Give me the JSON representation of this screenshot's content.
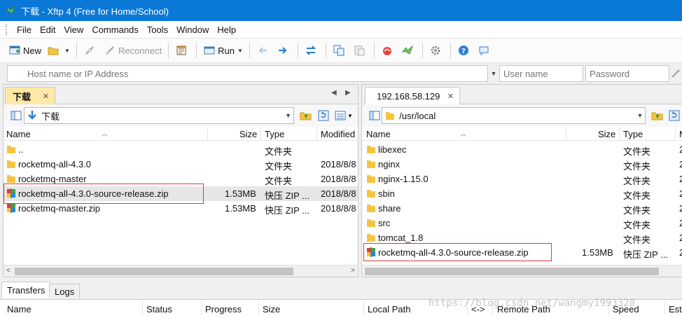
{
  "window": {
    "title": "下载 - Xftp 4 (Free for Home/School)"
  },
  "menu": [
    "File",
    "Edit",
    "View",
    "Commands",
    "Tools",
    "Window",
    "Help"
  ],
  "toolbar": {
    "new_label": "New",
    "reconnect_label": "Reconnect",
    "run_label": "Run"
  },
  "address": {
    "host_placeholder": "Host name or IP Address",
    "user_placeholder": "User name",
    "password_placeholder": "Password"
  },
  "columns": {
    "name": "Name",
    "size": "Size",
    "type": "Type",
    "modified": "Modified"
  },
  "left_pane": {
    "tab_label": "下载",
    "path": "下载",
    "files": [
      {
        "name": "..",
        "size": "",
        "type": "文件夹",
        "modified": ""
      },
      {
        "name": "rocketmq-all-4.3.0",
        "size": "",
        "type": "文件夹",
        "modified": "2018/8/8"
      },
      {
        "name": "rocketmq-master",
        "size": "",
        "type": "文件夹",
        "modified": "2018/8/8"
      },
      {
        "name": "rocketmq-all-4.3.0-source-release.zip",
        "size": "1.53MB",
        "type": "快压 ZIP ...",
        "modified": "2018/8/8"
      },
      {
        "name": "rocketmq-master.zip",
        "size": "1.53MB",
        "type": "快压 ZIP ...",
        "modified": "2018/8/8"
      }
    ]
  },
  "right_pane": {
    "tab_label": "192.168.58.129",
    "path": "/usr/local",
    "files": [
      {
        "name": "libexec",
        "size": "",
        "type": "文件夹",
        "modified": "2"
      },
      {
        "name": "nginx",
        "size": "",
        "type": "文件夹",
        "modified": "2"
      },
      {
        "name": "nginx-1.15.0",
        "size": "",
        "type": "文件夹",
        "modified": "2"
      },
      {
        "name": "sbin",
        "size": "",
        "type": "文件夹",
        "modified": "2"
      },
      {
        "name": "share",
        "size": "",
        "type": "文件夹",
        "modified": "2"
      },
      {
        "name": "src",
        "size": "",
        "type": "文件夹",
        "modified": "2"
      },
      {
        "name": "tomcat_1.8",
        "size": "",
        "type": "文件夹",
        "modified": "2"
      },
      {
        "name": "rocketmq-all-4.3.0-source-release.zip",
        "size": "1.53MB",
        "type": "快压 ZIP ...",
        "modified": "2"
      }
    ]
  },
  "bottom": {
    "tabs": [
      "Transfers",
      "Logs"
    ],
    "columns": [
      "Name",
      "Status",
      "Progress",
      "Size",
      "Local Path",
      "<->",
      "Remote Path",
      "Speed",
      "Esti"
    ]
  },
  "watermark": "https://blog.csdn.net/wangmy1993328",
  "colors": {
    "titlebar": "#0a78d7",
    "local_tab": "#fde8a8",
    "highlight_box": "#e0383e",
    "folder": "#f5c542"
  }
}
